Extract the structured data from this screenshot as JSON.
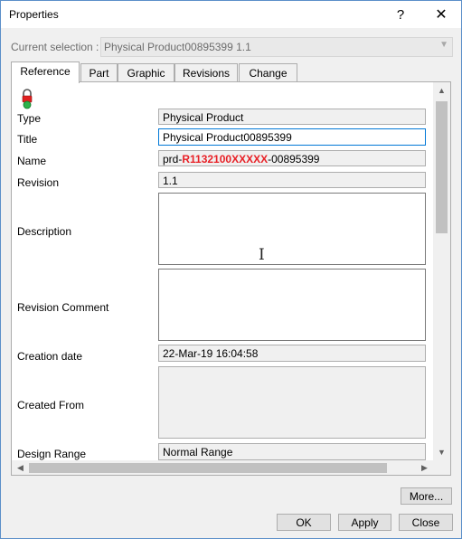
{
  "window": {
    "title": "Properties",
    "help_label": "?",
    "close_label": "✕"
  },
  "selection": {
    "label": "Current selection :",
    "value": "Physical Product00895399 1.1"
  },
  "tabs": [
    {
      "label": "Reference",
      "active": true
    },
    {
      "label": "Part"
    },
    {
      "label": "Graphic"
    },
    {
      "label": "Revisions"
    },
    {
      "label": "Change"
    }
  ],
  "fields": {
    "type": {
      "label": "Type",
      "value": "Physical Product"
    },
    "title": {
      "label": "Title",
      "value": "Physical Product00895399"
    },
    "name": {
      "label": "Name",
      "prefix": "prd-",
      "highlight": "R1132100XXXXX",
      "suffix": "-00895399"
    },
    "revision": {
      "label": "Revision",
      "value": "1.1"
    },
    "description": {
      "label": "Description",
      "value": ""
    },
    "revision_comment": {
      "label": "Revision Comment",
      "value": ""
    },
    "creation_date": {
      "label": "Creation date",
      "value": "22-Mar-19 16:04:58"
    },
    "created_from": {
      "label": "Created From",
      "value": ""
    },
    "design_range": {
      "label": "Design Range",
      "value": "Normal Range"
    }
  },
  "buttons": {
    "more": "More...",
    "ok": "OK",
    "apply": "Apply",
    "close": "Close"
  },
  "colors": {
    "highlight_red": "#e82127",
    "focus_blue": "#0078d7",
    "lock_green": "#2db24a",
    "lock_red": "#e02020"
  }
}
